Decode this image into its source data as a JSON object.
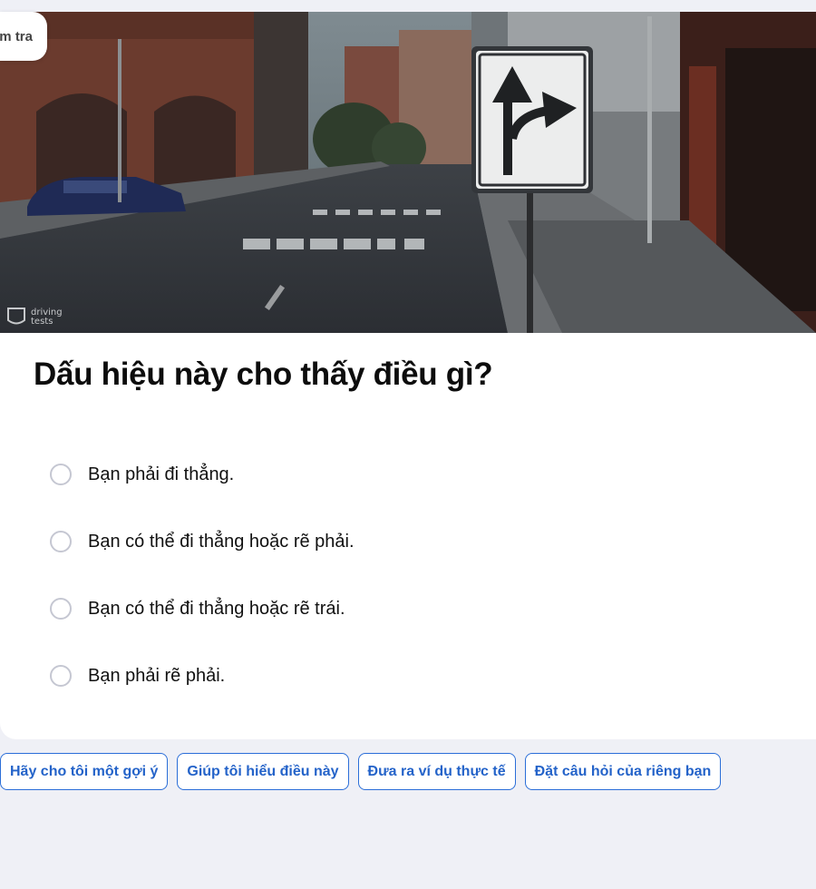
{
  "tab": {
    "label": "Kiểm tra"
  },
  "hero": {
    "watermark": "driving\ntests",
    "watermark_line1": "driving",
    "watermark_line2": "tests"
  },
  "question": {
    "title": "Dấu hiệu này cho thấy điều gì?"
  },
  "options": [
    {
      "label": "Bạn phải đi thẳng."
    },
    {
      "label": "Bạn có thể đi thẳng hoặc rẽ phải."
    },
    {
      "label": "Bạn có thể đi thẳng hoặc rẽ trái."
    },
    {
      "label": "Bạn phải rẽ phải."
    }
  ],
  "suggestions": [
    {
      "label": "Hãy cho tôi một gợi ý"
    },
    {
      "label": "Giúp tôi hiểu điều này"
    },
    {
      "label": "Đưa ra ví dụ thực tế"
    },
    {
      "label": "Đặt câu hỏi của riêng bạn"
    }
  ],
  "colors": {
    "accent": "#2463c9",
    "background": "#eff0f6"
  }
}
